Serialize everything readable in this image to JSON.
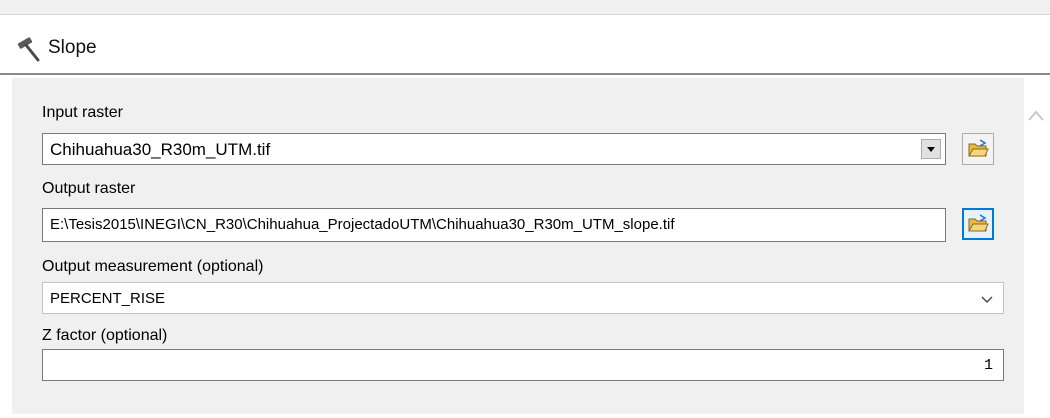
{
  "window": {
    "title": "Slope",
    "title_icon": "hammer-icon"
  },
  "form": {
    "input_raster": {
      "label": "Input raster",
      "value": "Chihuahua30_R30m_UTM.tif",
      "browse_icon": "folder-open-icon"
    },
    "output_raster": {
      "label": "Output raster",
      "value": "E:\\Tesis2015\\INEGI\\CN_R30\\Chihuahua_ProjectadoUTM\\Chihuahua30_R30m_UTM_slope.tif",
      "browse_icon": "folder-open-icon"
    },
    "output_measurement": {
      "label": "Output measurement (optional)",
      "value": "PERCENT_RISE"
    },
    "z_factor": {
      "label": "Z factor (optional)",
      "value": "1"
    }
  },
  "colors": {
    "panel_bg": "#f0f0f0",
    "focus_accent": "#0078d7",
    "folder_yellow": "#e8b84a"
  }
}
